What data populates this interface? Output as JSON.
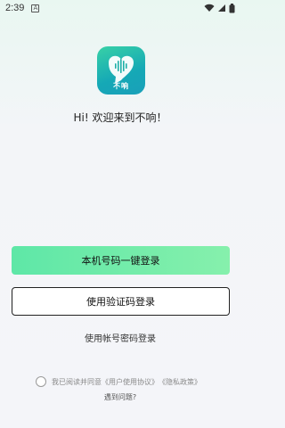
{
  "status_bar": {
    "time": "2:39",
    "notification_letter": "A"
  },
  "app": {
    "logo_caption": "不响",
    "greeting": "Hi! 欢迎来到不响！"
  },
  "buttons": {
    "one_click_login": "本机号码一键登录",
    "sms_login": "使用验证码登录",
    "password_login": "使用帐号密码登录"
  },
  "agreement": {
    "prefix": "我已阅读并同意",
    "user_agreement": "《用户使用协议》",
    "privacy_policy": "《隐私政策》",
    "checked": false
  },
  "help": {
    "label": "遇到问题?"
  },
  "colors": {
    "primary_gradient_start": "#5ee7a7",
    "primary_gradient_end": "#86f0ac",
    "logo_start": "#38d1a6",
    "logo_end": "#1aa0b9"
  }
}
